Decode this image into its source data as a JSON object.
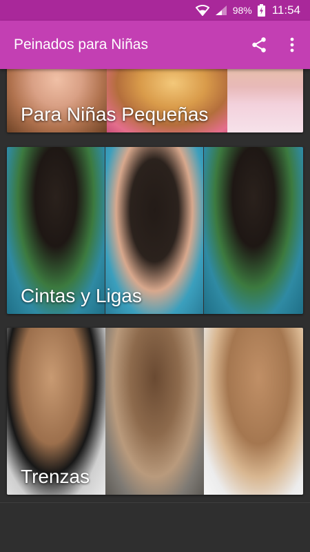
{
  "status_bar": {
    "battery": "98%",
    "time": "11:54",
    "icons": [
      "wifi-icon",
      "signal-icon",
      "battery-charging-icon"
    ]
  },
  "app_bar": {
    "title": "Peinados para Niñas",
    "actions": [
      "share-icon",
      "more-vert-icon"
    ]
  },
  "categories": [
    {
      "label": "Para Niñas Pequeñas"
    },
    {
      "label": "Cintas y Ligas"
    },
    {
      "label": "Trenzas"
    }
  ],
  "colors": {
    "status_bar": "#a9289a",
    "app_bar": "#c33fb3",
    "background": "#2f2f2f",
    "text": "#ffffff"
  }
}
